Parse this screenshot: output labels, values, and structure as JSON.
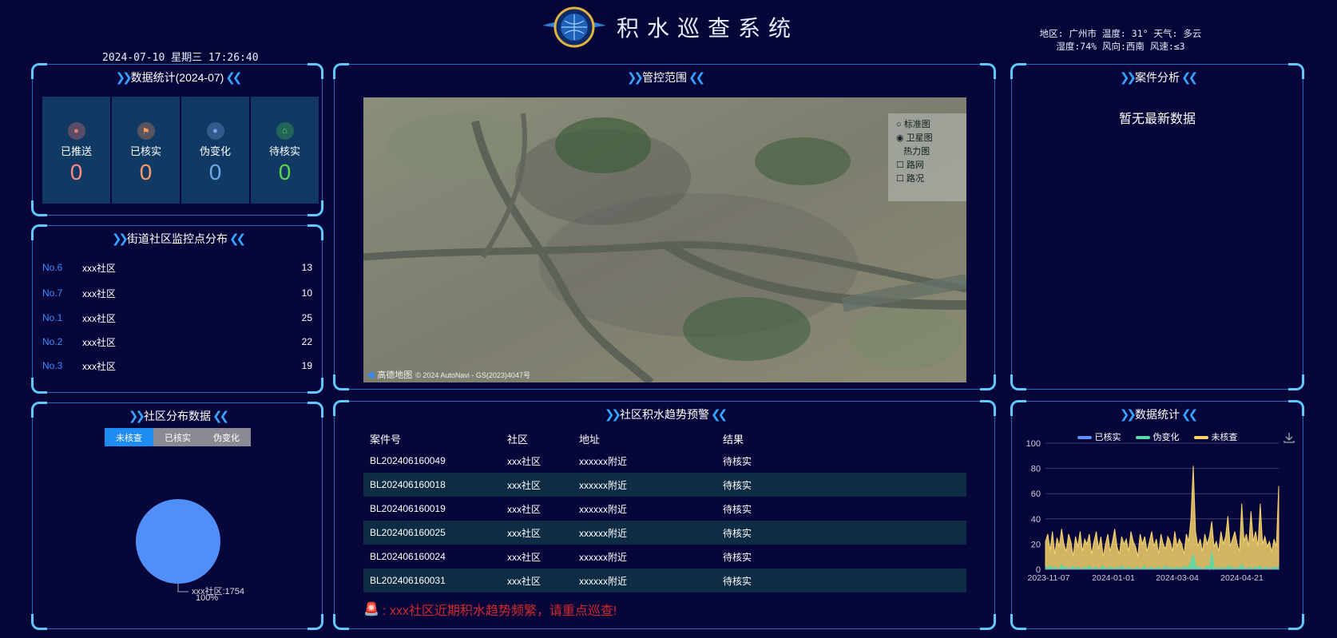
{
  "header": {
    "title": "积水巡查系统",
    "datetime": "2024-07-10 星期三 17:26:40",
    "weather_line1": "地区: 广州市 温度: 31° 天气: 多云",
    "weather_line2": "湿度:74% 风向:西南 风速:≤3"
  },
  "stats_panel": {
    "title": "数据统计(2024-07)",
    "items": [
      {
        "label": "已推送",
        "value": "0",
        "color": "#ff8a80",
        "icon": "pin-icon"
      },
      {
        "label": "已核实",
        "value": "0",
        "color": "#ff9a6a",
        "icon": "flag-icon"
      },
      {
        "label": "伪变化",
        "value": "0",
        "color": "#6aa8e8",
        "icon": "circle-icon"
      },
      {
        "label": "待核实",
        "value": "0",
        "color": "#5fd44f",
        "icon": "house-icon"
      }
    ]
  },
  "community_panel": {
    "title": "街道社区监控点分布",
    "rows": [
      {
        "no": "No.6",
        "name": "xxx社区",
        "value": "13"
      },
      {
        "no": "No.7",
        "name": "xxx社区",
        "value": "10"
      },
      {
        "no": "No.1",
        "name": "xxx社区",
        "value": "25"
      },
      {
        "no": "No.2",
        "name": "xxx社区",
        "value": "22"
      },
      {
        "no": "No.3",
        "name": "xxx社区",
        "value": "19"
      }
    ]
  },
  "distribution_panel": {
    "title": "社区分布数据",
    "tabs": [
      "未核查",
      "已核实",
      "伪变化"
    ],
    "active_tab": "未核查",
    "pie_label": "xxx社区:1754",
    "pie_percent": "100%"
  },
  "map_panel": {
    "title": "管控范围",
    "layer_options": [
      "标准图",
      "卫星图",
      "热力图",
      "路网",
      "路况"
    ],
    "selected_layer": "卫星图",
    "attribution_brand": "高德地图",
    "attribution_text": "© 2024 AutoNavi - GS(2023)4047号"
  },
  "case_panel": {
    "title": "案件分析",
    "empty_text": "暂无最新数据"
  },
  "trend_panel": {
    "title": "社区积水趋势预警",
    "columns": [
      "案件号",
      "社区",
      "地址",
      "结果"
    ],
    "rows": [
      [
        "BL202406160049",
        "xxx社区",
        "xxxxxx附近",
        "待核实"
      ],
      [
        "BL202406160018",
        "xxx社区",
        "xxxxxx附近",
        "待核实"
      ],
      [
        "BL202406160019",
        "xxx社区",
        "xxxxxx附近",
        "待核实"
      ],
      [
        "BL202406160025",
        "xxx社区",
        "xxxxxx附近",
        "待核实"
      ],
      [
        "BL202406160024",
        "xxx社区",
        "xxxxxx附近",
        "待核实"
      ],
      [
        "BL202406160031",
        "xxx社区",
        "xxxxxx附近",
        "待核实"
      ]
    ],
    "alarm_text": ": xxx社区近期积水趋势频繁，请重点巡查!"
  },
  "stats_chart_panel": {
    "title": "数据统计"
  },
  "chart_data": {
    "type": "area",
    "legend": [
      "已核实",
      "伪变化",
      "未核查"
    ],
    "colors": {
      "已核实": "#5b8ff9",
      "伪变化": "#5ad8a6",
      "未核查": "#f6d36b"
    },
    "x_ticks": [
      "2023-11-07",
      "2024-01-01",
      "2024-03-04",
      "2024-04-21"
    ],
    "ylim": [
      0,
      100
    ],
    "y_ticks": [
      0,
      20,
      40,
      60,
      80,
      100
    ],
    "series": [
      {
        "name": "未核查",
        "values": [
          22,
          28,
          15,
          30,
          12,
          25,
          18,
          32,
          20,
          14,
          28,
          22,
          10,
          26,
          18,
          30,
          14,
          24,
          20,
          28,
          12,
          22,
          30,
          16,
          26,
          10,
          20,
          28,
          14,
          22,
          32,
          18,
          12,
          26,
          20,
          24,
          14,
          30,
          22,
          18,
          10,
          28,
          20,
          26,
          14,
          22,
          30,
          18,
          24,
          12,
          28,
          20,
          16,
          26,
          22,
          14,
          30,
          18,
          24,
          20,
          12,
          28,
          22,
          40,
          82,
          30,
          18,
          24,
          14,
          28,
          20,
          26,
          38,
          18,
          22,
          14,
          30,
          20,
          26,
          42,
          18,
          24,
          30,
          20,
          14,
          52,
          22,
          28,
          18,
          46,
          22,
          30,
          18,
          52,
          20,
          26,
          18,
          22,
          14,
          24,
          18,
          66
        ]
      },
      {
        "name": "伪变化",
        "values": [
          2,
          1,
          3,
          0,
          2,
          1,
          0,
          4,
          1,
          2,
          0,
          1,
          3,
          0,
          2,
          1,
          0,
          2,
          1,
          3,
          0,
          1,
          2,
          0,
          1,
          3,
          0,
          1,
          2,
          0,
          1,
          2,
          0,
          3,
          1,
          0,
          2,
          1,
          0,
          1,
          2,
          0,
          1,
          3,
          0,
          1,
          2,
          0,
          1,
          2,
          0,
          1,
          3,
          0,
          2,
          1,
          0,
          2,
          1,
          0,
          3,
          1,
          2,
          6,
          12,
          3,
          1,
          2,
          0,
          1,
          3,
          0,
          14,
          2,
          1,
          0,
          2,
          1,
          0,
          3,
          1,
          2,
          0,
          1,
          2,
          4,
          1,
          0,
          2,
          1,
          0,
          2,
          1,
          3,
          0,
          1,
          2,
          0,
          1,
          2,
          1,
          2
        ]
      },
      {
        "name": "已核实",
        "values": [
          0,
          0,
          0,
          0,
          0,
          0,
          0,
          0,
          0,
          0,
          0,
          0,
          0,
          0,
          0,
          0,
          0,
          0,
          0,
          0,
          0,
          0,
          0,
          0,
          0,
          0,
          0,
          0,
          0,
          0,
          0,
          0,
          0,
          0,
          0,
          0,
          0,
          0,
          0,
          0,
          0,
          0,
          0,
          0,
          0,
          0,
          0,
          0,
          0,
          0,
          0,
          0,
          0,
          0,
          0,
          0,
          0,
          0,
          0,
          0,
          0,
          0,
          0,
          0,
          0,
          0,
          0,
          0,
          0,
          0,
          0,
          0,
          0,
          0,
          0,
          0,
          0,
          0,
          0,
          0,
          0,
          0,
          0,
          0,
          0,
          0,
          0,
          0,
          0,
          0,
          0,
          0,
          0,
          0,
          0,
          0,
          0,
          0,
          0,
          0,
          0,
          0
        ]
      }
    ]
  }
}
